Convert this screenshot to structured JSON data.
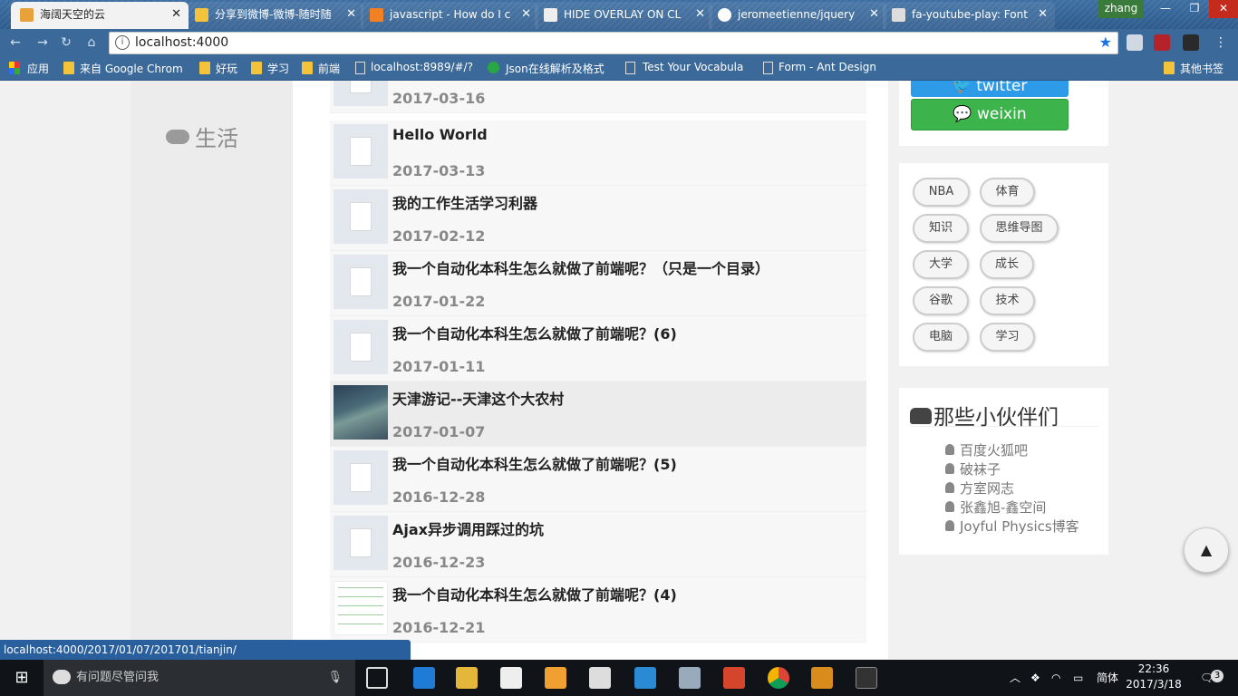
{
  "browser": {
    "tabs": [
      {
        "title": "海阔天空的云",
        "active": true
      },
      {
        "title": "分享到微博-微博-随时随"
      },
      {
        "title": "javascript - How do I c"
      },
      {
        "title": "HIDE OVERLAY ON CL"
      },
      {
        "title": "jeromeetienne/jquery"
      },
      {
        "title": "fa-youtube-play: Font"
      }
    ],
    "profile": "zhang",
    "address": "localhost:4000",
    "bookmarks": [
      "应用",
      "来自 Google Chrom",
      "好玩",
      "学习",
      "前端",
      "localhost:8989/#/?",
      "Json在线解析及格式",
      "Test Your Vocabula",
      "Form - Ant Design",
      "其他书签"
    ],
    "status_url": "localhost:4000/2017/01/07/201701/tianjin/"
  },
  "sidebar": {
    "category": "生活"
  },
  "posts": [
    {
      "title": "",
      "date": "2017-03-16"
    },
    {
      "title": "Hello World",
      "date": "2017-03-13"
    },
    {
      "title": "我的工作生活学习利器",
      "date": "2017-02-12"
    },
    {
      "title": "我一个自动化本科生怎么就做了前端呢？（只是一个目录）",
      "date": "2017-01-22"
    },
    {
      "title": "我一个自动化本科生怎么就做了前端呢？(6)",
      "date": "2017-01-11"
    },
    {
      "title": "天津游记--天津这个大农村",
      "date": "2017-01-07"
    },
    {
      "title": "我一个自动化本科生怎么就做了前端呢？(5)",
      "date": "2016-12-28"
    },
    {
      "title": "Ajax异步调用踩过的坑",
      "date": "2016-12-23"
    },
    {
      "title": "我一个自动化本科生怎么就做了前端呢？(4)",
      "date": "2016-12-21"
    }
  ],
  "share": {
    "twitter": "twitter",
    "weixin": "weixin"
  },
  "tags": [
    "NBA",
    "体育",
    "知识",
    "思维导图",
    "大学",
    "成长",
    "谷歌",
    "技术",
    "电脑",
    "学习"
  ],
  "friends": {
    "title": "那些小伙伴们",
    "links": [
      "百度火狐吧",
      "破袜子",
      "方室网志",
      "张鑫旭-鑫空间",
      "Joyful Physics博客"
    ]
  },
  "taskbar": {
    "search_placeholder": "有问题尽管问我",
    "ime": "简体",
    "time": "22:36",
    "date": "2017/3/18",
    "notifications": "3"
  }
}
